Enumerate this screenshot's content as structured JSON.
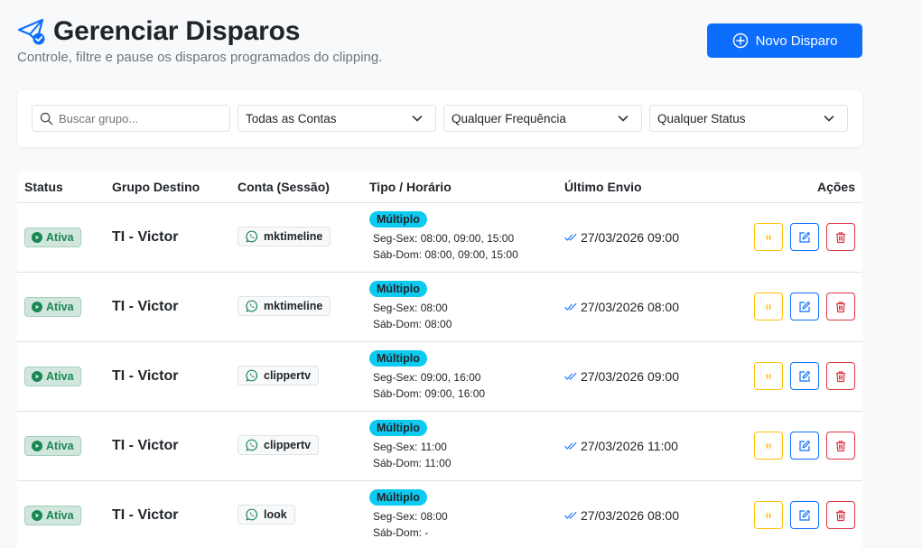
{
  "header": {
    "title": "Gerenciar Disparos",
    "subtitle": "Controle, filtre e pause os disparos programados do clipping.",
    "new_button": "Novo Disparo"
  },
  "filters": {
    "search_placeholder": "Buscar grupo...",
    "conta": "Todas as Contas",
    "frequencia": "Qualquer Frequência",
    "status": "Qualquer Status"
  },
  "table": {
    "headers": {
      "status": "Status",
      "grupo": "Grupo Destino",
      "conta": "Conta (Sessão)",
      "tipo": "Tipo / Horário",
      "ultimo": "Último Envio",
      "acoes": "Ações"
    },
    "rows": [
      {
        "status": "Ativa",
        "grupo": "TI - Victor",
        "conta": "mktimeline",
        "tipo": "Múltiplo",
        "seg_sex": "Seg-Sex: 08:00, 09:00, 15:00",
        "sab_dom": "Sáb-Dom: 08:00, 09:00, 15:00",
        "ultimo": "27/03/2026 09:00"
      },
      {
        "status": "Ativa",
        "grupo": "TI - Victor",
        "conta": "mktimeline",
        "tipo": "Múltiplo",
        "seg_sex": "Seg-Sex: 08:00",
        "sab_dom": "Sáb-Dom: 08:00",
        "ultimo": "27/03/2026 08:00"
      },
      {
        "status": "Ativa",
        "grupo": "TI - Victor",
        "conta": "clippertv",
        "tipo": "Múltiplo",
        "seg_sex": "Seg-Sex: 09:00, 16:00",
        "sab_dom": "Sáb-Dom: 09:00, 16:00",
        "ultimo": "27/03/2026 09:00"
      },
      {
        "status": "Ativa",
        "grupo": "TI - Victor",
        "conta": "clippertv",
        "tipo": "Múltiplo",
        "seg_sex": "Seg-Sex: 11:00",
        "sab_dom": "Sáb-Dom: 11:00",
        "ultimo": "27/03/2026 11:00"
      },
      {
        "status": "Ativa",
        "grupo": "TI - Victor",
        "conta": "look",
        "tipo": "Múltiplo",
        "seg_sex": "Seg-Sex: 08:00",
        "sab_dom": "Sáb-Dom: -",
        "ultimo": "27/03/2026 08:00"
      }
    ]
  },
  "icons": {
    "title": "paper-plane-check-icon",
    "new": "plus-circle-icon",
    "search": "search-icon",
    "dropdown": "chevron-down-icon",
    "status": "play-circle-icon",
    "conta": "whatsapp-icon",
    "ultimo": "double-check-icon",
    "pause": "pause-icon",
    "edit": "edit-icon",
    "delete": "trash-icon"
  },
  "colors": {
    "primary": "#0d6efd",
    "success": "#198754",
    "info": "#0dcaf0",
    "warning": "#ffc107",
    "danger": "#dc3545"
  }
}
